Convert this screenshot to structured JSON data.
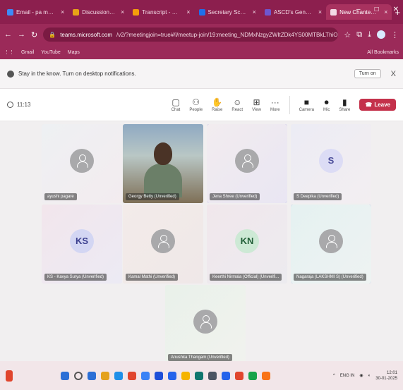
{
  "browser": {
    "tabs": [
      {
        "label": "Email - pa mmos",
        "color": "#3d8af7"
      },
      {
        "label": "Discussion ec",
        "color": "#e8a317"
      },
      {
        "label": "Transcript - Union",
        "color": "#f59e0b"
      },
      {
        "label": "Secretary Screens",
        "color": "#1f6feb"
      },
      {
        "label": "ASCD's Gen Mn",
        "color": "#6e56cf"
      },
      {
        "label": "New Chanted Prm",
        "color": "#f3dbe6"
      }
    ],
    "new_tab": "+",
    "window_controls": [
      "–",
      "□",
      "✕"
    ],
    "url_host": "teams.microsoft.com",
    "url_path": "/v2/?meetingjoin=true#/l/meetup-join/19:meeting_NDMxNzgyZWItZDk4YS00MTBkLThiOGEtNzM4YWVlODEw...",
    "bookmarks": [
      "Gmail",
      "YouTube",
      "Maps"
    ],
    "all_bookmarks": "All Bookmarks"
  },
  "notification": {
    "text": "Stay in the know. Turn on desktop notifications.",
    "turn_on": "Turn on",
    "close": "X"
  },
  "meeting": {
    "timer": "11:13",
    "tools": [
      {
        "name": "chat",
        "icon": "▢",
        "label": "Chat"
      },
      {
        "name": "people",
        "icon": "⚇",
        "label": "People"
      },
      {
        "name": "raise",
        "icon": "✋",
        "label": "Raise"
      },
      {
        "name": "react",
        "icon": "☺",
        "label": "React"
      },
      {
        "name": "view",
        "icon": "⊞",
        "label": "View"
      },
      {
        "name": "more",
        "icon": "···",
        "label": "More"
      }
    ],
    "media": [
      {
        "name": "camera",
        "icon": "■",
        "label": "Camera"
      },
      {
        "name": "mic",
        "icon": "⏺",
        "label": "Mic"
      },
      {
        "name": "share",
        "icon": "▮",
        "label": "Share"
      }
    ],
    "leave": "Leave"
  },
  "participants": [
    {
      "name": "ayushi pagare",
      "initials": "",
      "highlight": false,
      "bg": "linear-gradient(135deg,#eef0f3,#f3ecef)",
      "video": false
    },
    {
      "name": "Georgy Betty (Unverified)",
      "initials": "",
      "highlight": false,
      "bg": "linear-gradient(180deg,#8fa9c2 0%,#b9c7c5 40%,#7e6f56 100%)",
      "video": true
    },
    {
      "name": "Jena Shree (Unverified)",
      "initials": "",
      "highlight": true,
      "bg": "linear-gradient(135deg,#f2ecef,#e9e6f3)",
      "video": false
    },
    {
      "name": "S Deepika (Unverified)",
      "initials": "S",
      "highlight": false,
      "bg": "linear-gradient(135deg,#ececf4,#f3eef1)",
      "video": false
    },
    {
      "name": "KS - Kavya Surya (Unverified)",
      "initials": "KS",
      "highlight": false,
      "bg": "linear-gradient(135deg,#f2e6ec,#eceaf4)",
      "video": false
    },
    {
      "name": "Kamal Mathi (Unverified)",
      "initials": "",
      "highlight": false,
      "bg": "linear-gradient(135deg,#f3ebe9,#efe8e8)",
      "video": false
    },
    {
      "name": "Keerthi Nirmala (Official) (Unverifi...",
      "initials": "KN",
      "highlight": false,
      "bg": "linear-gradient(135deg,#f1e7ec,#ecebef)",
      "video": false
    },
    {
      "name": "Nagaraja (LAKSHMI S) (Unverified)",
      "initials": "",
      "highlight": true,
      "bg": "linear-gradient(135deg,#e5f1f1,#eef3f2)",
      "video": false
    },
    {
      "name": "Anushka Thangam (Unverified)",
      "initials": "",
      "highlight": false,
      "bg": "linear-gradient(135deg,#e9f1ea,#f1f2ee)",
      "video": false
    }
  ],
  "taskbar": {
    "icons": [
      "#2b6fd6",
      "#555",
      "#2b6fd6",
      "#e4a11b",
      "#1f8fe8",
      "#e0452d",
      "#3b82f6",
      "#1d4ed8",
      "#2563eb",
      "#f5b400",
      "#0f766e",
      "#4b5563",
      "#2563eb",
      "#e0452d",
      "#16a34a",
      "#f97316"
    ],
    "tray": "ENG IN",
    "time": "12:01",
    "date": "30-01-2025"
  }
}
